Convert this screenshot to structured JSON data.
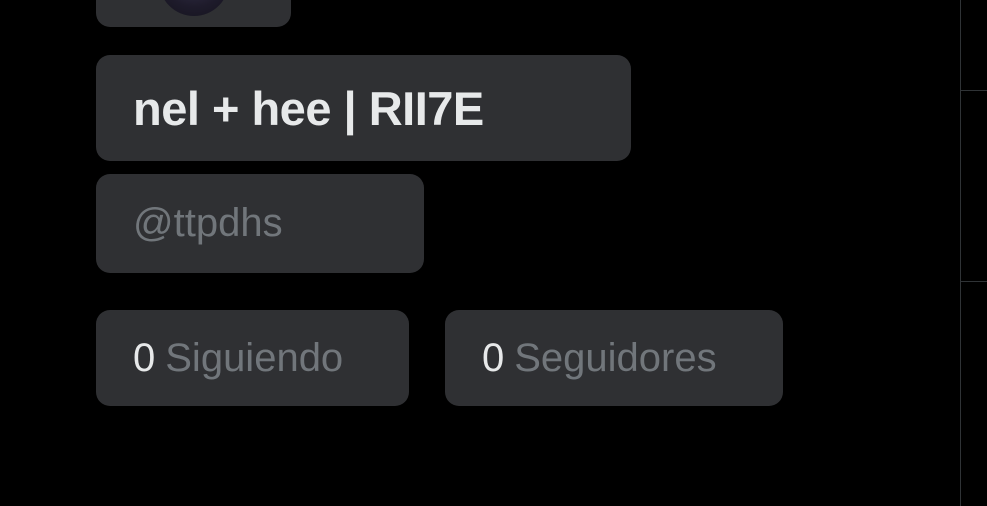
{
  "profile": {
    "display_name": "nel + hee | RII7E",
    "handle": "@ttpdhs",
    "following": {
      "count": "0",
      "label": "Siguiendo"
    },
    "followers": {
      "count": "0",
      "label": "Seguidores"
    }
  },
  "colors": {
    "background": "#000000",
    "chip_background": "#2f3033",
    "primary_text": "#e7e9ea",
    "secondary_text": "#71767b",
    "divider": "#2f3336"
  }
}
